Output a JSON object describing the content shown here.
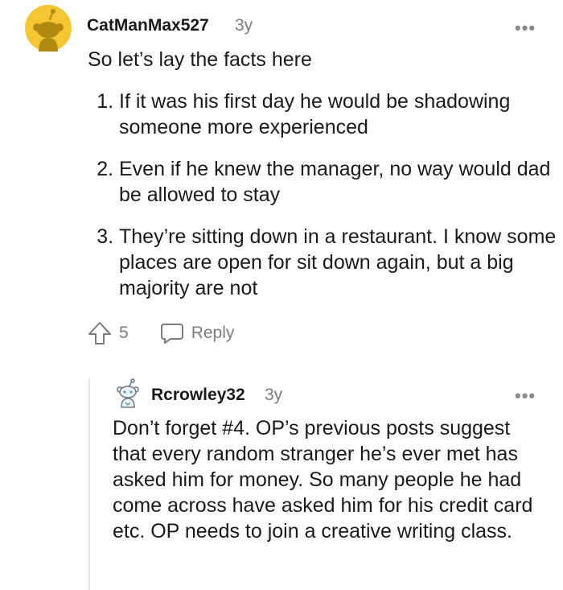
{
  "comment1": {
    "username": "CatManMax527",
    "age": "3y",
    "intro": "So let’s lay the facts here",
    "facts": [
      "If it was his first day he would be shadowing someone more experienced",
      "Even if he knew the manager, no way would dad be allowed to stay",
      "They’re sitting down in a restaurant. I know some places are open for sit down again, but a big majority are not"
    ],
    "votes": "5",
    "reply_label": "Reply",
    "more_label": "•••",
    "avatar_icon": "snoo-avatar-yellow"
  },
  "comment2": {
    "username": "Rcrowley32",
    "age": "3y",
    "text": "Don’t forget #4. OP’s previous posts suggest that every random stranger he’s ever met has asked him for money. So many people he had come across have asked him for his credit card etc. OP needs to join a creative writing class.",
    "more_label": "•••",
    "avatar_icon": "snoo-avatar-sketch"
  },
  "colors": {
    "text": "#1a1a1b",
    "meta": "#7c7c7c",
    "avatar_yellow": "#f5c532",
    "thread_line": "#e4e6e8"
  }
}
